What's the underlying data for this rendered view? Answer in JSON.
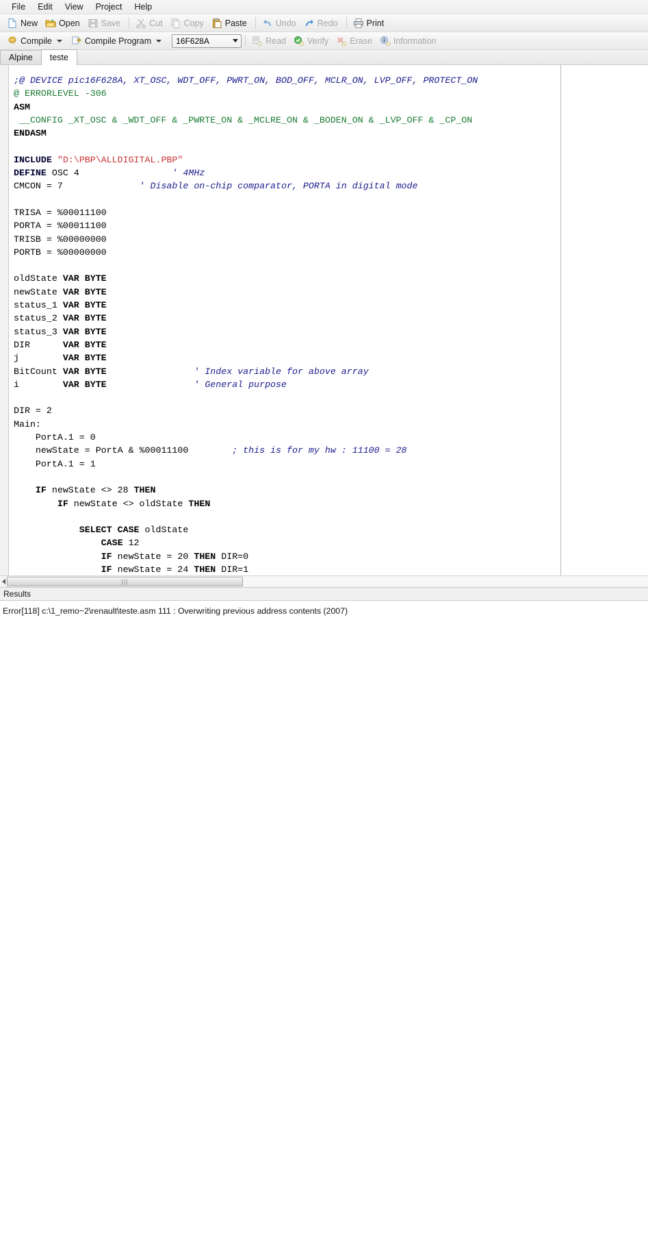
{
  "menubar": {
    "items": [
      "File",
      "Edit",
      "View",
      "Project",
      "Help"
    ]
  },
  "toolbar_main": {
    "new_label": "New",
    "open_label": "Open",
    "save_label": "Save",
    "cut_label": "Cut",
    "copy_label": "Copy",
    "paste_label": "Paste",
    "undo_label": "Undo",
    "redo_label": "Redo",
    "print_label": "Print"
  },
  "toolbar_compile": {
    "compile_label": "Compile",
    "compile_program_label": "Compile Program",
    "device_value": "16F628A",
    "read_label": "Read",
    "verify_label": "Verify",
    "erase_label": "Erase",
    "information_label": "Information"
  },
  "tabs": [
    {
      "label": "Alpine",
      "active": false
    },
    {
      "label": "teste",
      "active": true
    }
  ],
  "editor": {
    "lines": [
      [
        {
          "t": ";@ DEVICE pic16F628A, XT_OSC, WDT_OFF, PWRT_ON, BOD_OFF, MCLR_ON, LVP_OFF, PROTECT_ON",
          "c": "c"
        }
      ],
      [
        {
          "t": "@ ERRORLEVEL -306",
          "c": "g"
        }
      ],
      [
        {
          "t": "ASM",
          "c": "k"
        }
      ],
      [
        {
          "t": " __CONFIG _XT_OSC & _WDT_OFF & _PWRTE_ON & _MCLRE_ON & _BODEN_ON & _LVP_OFF & _CP_ON",
          "c": "g"
        }
      ],
      [
        {
          "t": "ENDASM",
          "c": "k"
        }
      ],
      [
        {
          "t": "",
          "c": "p"
        }
      ],
      [
        {
          "t": "INCLUDE ",
          "c": "kb"
        },
        {
          "t": "\"D:\\PBP\\ALLDIGITAL.PBP\"",
          "c": "s"
        }
      ],
      [
        {
          "t": "DEFINE ",
          "c": "kb"
        },
        {
          "t": "OSC 4                 ",
          "c": "p"
        },
        {
          "t": "' 4MHz",
          "c": "c"
        }
      ],
      [
        {
          "t": "CMCON = 7              ",
          "c": "p"
        },
        {
          "t": "' Disable on-chip comparator, PORTA in digital mode",
          "c": "c"
        }
      ],
      [
        {
          "t": "",
          "c": "p"
        }
      ],
      [
        {
          "t": "TRISA = %00011100",
          "c": "p"
        }
      ],
      [
        {
          "t": "PORTA = %00011100",
          "c": "p"
        }
      ],
      [
        {
          "t": "TRISB = %00000000",
          "c": "p"
        }
      ],
      [
        {
          "t": "PORTB = %00000000",
          "c": "p"
        }
      ],
      [
        {
          "t": "",
          "c": "p"
        }
      ],
      [
        {
          "t": "oldState ",
          "c": "p"
        },
        {
          "t": "VAR BYTE",
          "c": "k"
        }
      ],
      [
        {
          "t": "newState ",
          "c": "p"
        },
        {
          "t": "VAR BYTE",
          "c": "k"
        }
      ],
      [
        {
          "t": "status_1 ",
          "c": "p"
        },
        {
          "t": "VAR BYTE",
          "c": "k"
        }
      ],
      [
        {
          "t": "status_2 ",
          "c": "p"
        },
        {
          "t": "VAR BYTE",
          "c": "k"
        }
      ],
      [
        {
          "t": "status_3 ",
          "c": "p"
        },
        {
          "t": "VAR BYTE",
          "c": "k"
        }
      ],
      [
        {
          "t": "DIR      ",
          "c": "p"
        },
        {
          "t": "VAR BYTE",
          "c": "k"
        }
      ],
      [
        {
          "t": "j        ",
          "c": "p"
        },
        {
          "t": "VAR BYTE",
          "c": "k"
        }
      ],
      [
        {
          "t": "BitCount ",
          "c": "p"
        },
        {
          "t": "VAR BYTE",
          "c": "k"
        },
        {
          "t": "                ",
          "c": "p"
        },
        {
          "t": "' Index variable for above array",
          "c": "c"
        }
      ],
      [
        {
          "t": "i        ",
          "c": "p"
        },
        {
          "t": "VAR BYTE",
          "c": "k"
        },
        {
          "t": "                ",
          "c": "p"
        },
        {
          "t": "' General purpose",
          "c": "c"
        }
      ],
      [
        {
          "t": "",
          "c": "p"
        }
      ],
      [
        {
          "t": "DIR = 2",
          "c": "p"
        }
      ],
      [
        {
          "t": "Main:",
          "c": "p"
        }
      ],
      [
        {
          "t": "    PortA.1 = 0",
          "c": "p"
        }
      ],
      [
        {
          "t": "    newState = PortA & %00011100        ",
          "c": "p"
        },
        {
          "t": "; this is for my hw : 11100 = 28",
          "c": "c"
        }
      ],
      [
        {
          "t": "    PortA.1 = 1",
          "c": "p"
        }
      ],
      [
        {
          "t": "",
          "c": "p"
        }
      ],
      [
        {
          "t": "    ",
          "c": "p"
        },
        {
          "t": "IF",
          "c": "k"
        },
        {
          "t": " newState <> 28 ",
          "c": "p"
        },
        {
          "t": "THEN",
          "c": "k"
        }
      ],
      [
        {
          "t": "        ",
          "c": "p"
        },
        {
          "t": "IF",
          "c": "k"
        },
        {
          "t": " newState <> oldState ",
          "c": "p"
        },
        {
          "t": "THEN",
          "c": "k"
        }
      ],
      [
        {
          "t": "",
          "c": "p"
        }
      ],
      [
        {
          "t": "            ",
          "c": "p"
        },
        {
          "t": "SELECT CASE",
          "c": "k"
        },
        {
          "t": " oldState",
          "c": "p"
        }
      ],
      [
        {
          "t": "                ",
          "c": "p"
        },
        {
          "t": "CASE",
          "c": "k"
        },
        {
          "t": " 12",
          "c": "p"
        }
      ],
      [
        {
          "t": "                ",
          "c": "p"
        },
        {
          "t": "IF",
          "c": "k"
        },
        {
          "t": " newState = 20 ",
          "c": "p"
        },
        {
          "t": "THEN",
          "c": "k"
        },
        {
          "t": " DIR=0",
          "c": "p"
        }
      ],
      [
        {
          "t": "                ",
          "c": "p"
        },
        {
          "t": "IF",
          "c": "k"
        },
        {
          "t": " newState = 24 ",
          "c": "p"
        },
        {
          "t": "THEN",
          "c": "k"
        },
        {
          "t": " DIR=1",
          "c": "p"
        }
      ]
    ]
  },
  "scrollbar": {
    "left_arrow": "left-arrow",
    "grip": "|||"
  },
  "results": {
    "header": "Results",
    "lines": [
      "Error[118] c:\\1_remo~2\\renault\\teste.asm 111 : Overwriting previous address contents (2007)"
    ]
  },
  "colors": {
    "comment": "#1a1a8c",
    "green_directive": "#1a7a33",
    "string": "#c83232",
    "keyword": "#000000"
  }
}
